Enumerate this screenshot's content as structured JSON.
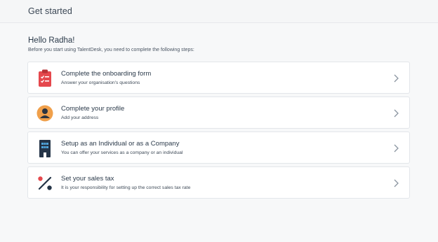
{
  "header": {
    "title": "Get started"
  },
  "intro": {
    "greeting": "Hello Radha!",
    "subtitle": "Before you start using TalentDesk, you need to complete the following steps:"
  },
  "steps": [
    {
      "icon": "clipboard-checklist-icon",
      "title": "Complete the onboarding form",
      "description": "Answer your organisation's questions",
      "icon_color": "#e5484d"
    },
    {
      "icon": "user-avatar-icon",
      "title": "Complete your profile",
      "description": "Add your address",
      "icon_color": "#f0a04b"
    },
    {
      "icon": "office-building-icon",
      "title": "Setup as an Individual or as a Company",
      "description": "You can offer your services as a company or an individual",
      "icon_color": "#243447"
    },
    {
      "icon": "percent-icon",
      "title": "Set your sales tax",
      "description": "It is your responsibility for setting up the correct sales tax rate",
      "icon_color": "#e5484d"
    }
  ]
}
